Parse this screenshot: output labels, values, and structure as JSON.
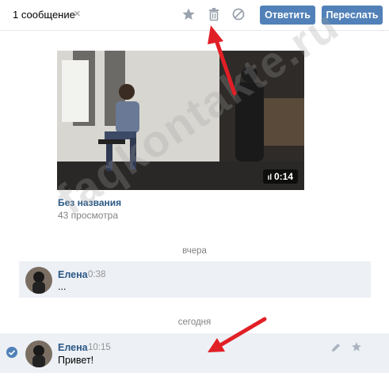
{
  "header": {
    "selection_count": "1 сообщение",
    "clear_icon": "×",
    "reply_label": "Ответить",
    "forward_label": "Переслать"
  },
  "attachment": {
    "duration": "0:14",
    "title": "Без названия",
    "views": "43 просмотра"
  },
  "messages": {
    "group1": {
      "date": "вчера",
      "sender": "Елена",
      "time": "0:38",
      "text": "..."
    },
    "group2": {
      "date": "сегодня",
      "sender": "Елена",
      "time": "10:15",
      "text": "Привет!"
    }
  },
  "watermark": "faqkontakte.ru",
  "colors": {
    "accent": "#5181b8",
    "link": "#2a5885",
    "selected_bg": "#edf0f5",
    "arrow": "#e11f26"
  },
  "icons": [
    "star-icon",
    "trash-icon",
    "ban-icon",
    "pencil-icon",
    "check-icon",
    "close-icon"
  ]
}
